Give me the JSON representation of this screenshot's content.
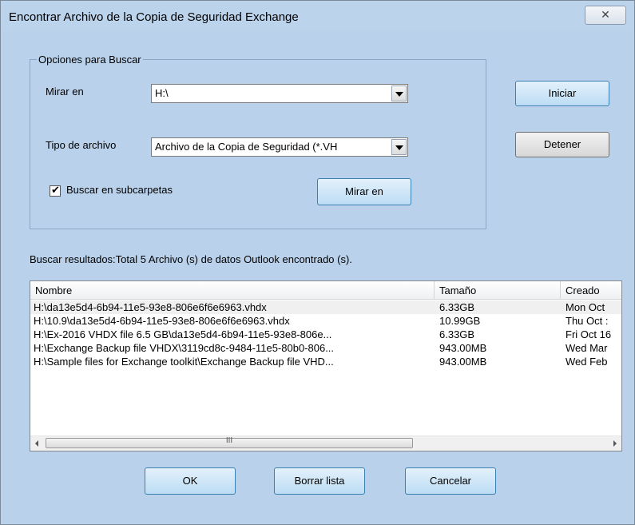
{
  "window": {
    "title": "Encontrar Archivo de la Copia de Seguridad Exchange",
    "close_glyph": "✕"
  },
  "options": {
    "legend": "Opciones para Buscar",
    "look_in_label": "Mirar en",
    "look_in_value": "H:\\",
    "file_type_label": "Tipo de archivo",
    "file_type_value": "Archivo de la Copia de Seguridad (*.VH",
    "subfolders_label": "Buscar en subcarpetas",
    "subfolders_checked": true,
    "browse_label": "Mirar en"
  },
  "buttons": {
    "start": "Iniciar",
    "stop": "Detener",
    "ok": "OK",
    "clear": "Borrar lista",
    "cancel": "Cancelar"
  },
  "results": {
    "summary": "Buscar resultados:Total 5 Archivo (s) de datos Outlook encontrado (s).",
    "columns": [
      "Nombre",
      "Tamaño",
      "Creado"
    ],
    "rows": [
      [
        "H:\\da13e5d4-6b94-11e5-93e8-806e6f6e6963.vhdx",
        "6.33GB",
        "Mon Oct"
      ],
      [
        "H:\\10.9\\da13e5d4-6b94-11e5-93e8-806e6f6e6963.vhdx",
        "10.99GB",
        "Thu Oct :"
      ],
      [
        "H:\\Ex-2016 VHDX file 6.5 GB\\da13e5d4-6b94-11e5-93e8-806e...",
        "6.33GB",
        "Fri Oct 16"
      ],
      [
        "H:\\Exchange Backup file VHDX\\3119cd8c-9484-11e5-80b0-806...",
        "943.00MB",
        "Wed Mar"
      ],
      [
        "H:\\Sample files  for Exchange toolkit\\Exchange Backup file VHD...",
        "943.00MB",
        "Wed Feb"
      ]
    ],
    "scroll_grip": "III"
  },
  "icons": {
    "close": "close-icon",
    "dropdown": "chevron-down-icon",
    "check": "checkmark-icon"
  }
}
